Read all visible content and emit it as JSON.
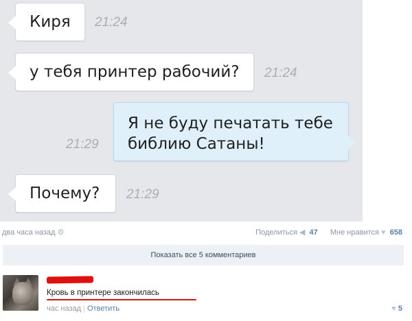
{
  "messages": [
    {
      "text": "Киря",
      "time": "21:24",
      "direction": "in"
    },
    {
      "text": "у тебя принтер рабочий?",
      "time": "21:24",
      "direction": "in"
    },
    {
      "text_line1": "Я не буду печатать тебе",
      "text_line2": "библию Сатаны!",
      "time": "21:29",
      "direction": "out"
    },
    {
      "text": "Почему?",
      "time": "21:29",
      "direction": "in"
    }
  ],
  "post_meta": {
    "posted": "два часа назад",
    "share_label": "Поделиться",
    "share_count": "47",
    "like_label": "Мне нравится",
    "like_count": "658"
  },
  "show_all_comments": "Показать все 5 комментариев",
  "comment": {
    "text": "Кровь в принтере закончилась",
    "time": "час назад",
    "reply_label": "Ответить",
    "like_count": "5"
  },
  "colors": {
    "chat_background": "#e5e7ea",
    "outgoing_bubble": "#dff0fb",
    "incoming_bubble": "#ffffff",
    "link": "#5b7fa6",
    "highlight_red": "#e11010"
  },
  "icons": [
    "gear-icon",
    "megaphone-icon",
    "heart-icon"
  ]
}
